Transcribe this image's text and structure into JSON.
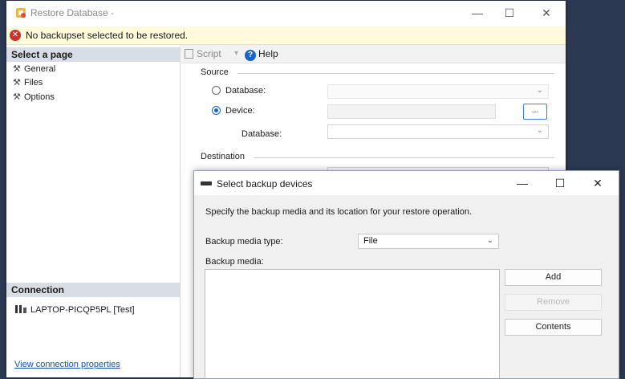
{
  "main_window": {
    "title": "Restore Database -",
    "minimize_glyph": "—",
    "maximize_glyph": "☐",
    "close_glyph": "✕",
    "error_text": "No backupset selected to be restored.",
    "error_icon_glyph": "✕"
  },
  "left_pane": {
    "select_page_header": "Select a page",
    "pages": [
      {
        "label": "General"
      },
      {
        "label": "Files"
      },
      {
        "label": "Options"
      }
    ],
    "connection_header": "Connection",
    "connection_name": "LAPTOP-PICQP5PL [Test]",
    "view_connection_properties": "View connection properties"
  },
  "toolbar": {
    "script_label": "Script",
    "dropdown_glyph": "▾",
    "help_label": "Help",
    "help_glyph": "?"
  },
  "source": {
    "section_label": "Source",
    "database_radio_label": "Database:",
    "device_radio_label": "Device:",
    "selected": "Device",
    "browse_button_label": "...",
    "database_label": "Database:"
  },
  "destination": {
    "section_label": "Destination"
  },
  "dialog": {
    "title": "Select backup devices",
    "minimize_glyph": "—",
    "maximize_glyph": "☐",
    "close_glyph": "✕",
    "description": "Specify the backup media and its location for your restore operation.",
    "media_type_label": "Backup media type:",
    "media_type_value": "File",
    "backup_media_label": "Backup media:",
    "add_label": "Add",
    "remove_label": "Remove",
    "contents_label": "Contents"
  },
  "icons": {
    "chevron": "⌄",
    "wrench": "🔧"
  },
  "colors": {
    "accent": "#1a64c8",
    "error": "#c9332a",
    "error_bar": "#fdfbdc",
    "pane_header": "#d9dde5",
    "desktop": "#2b3a52"
  }
}
